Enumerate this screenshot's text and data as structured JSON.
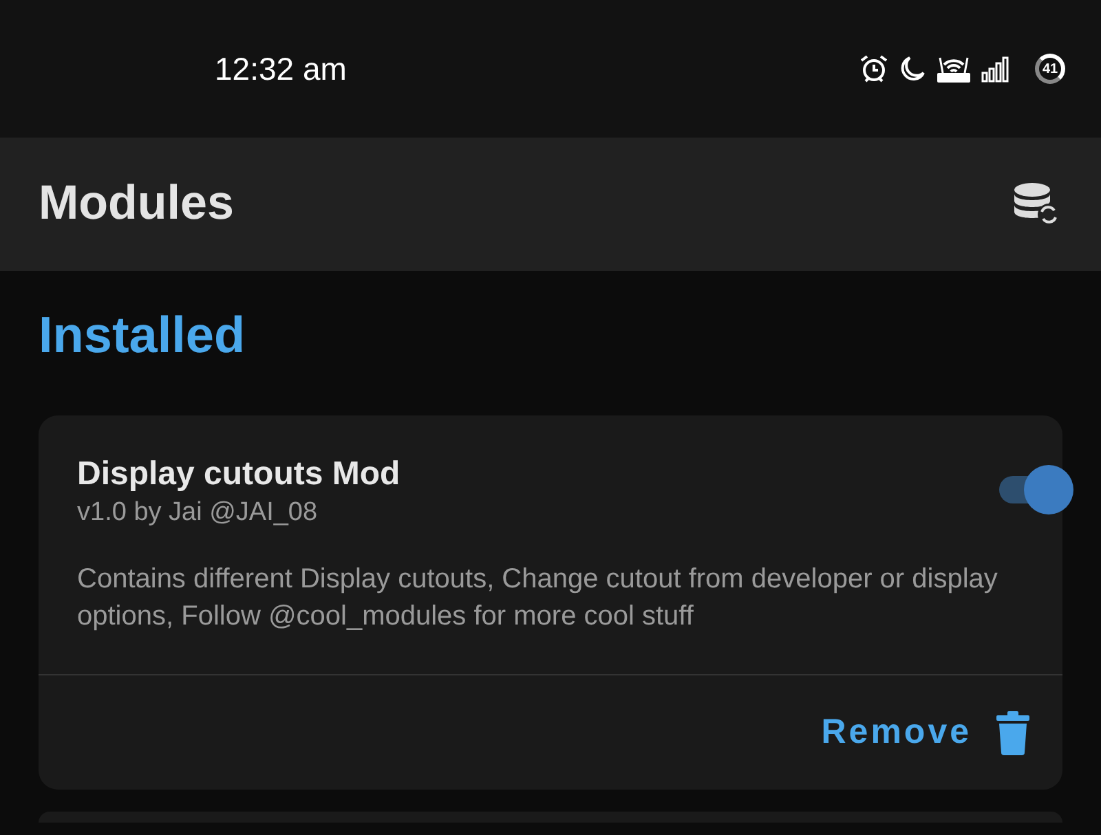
{
  "status_bar": {
    "time": "12:32 am",
    "battery": "41"
  },
  "app_bar": {
    "title": "Modules"
  },
  "section": {
    "title": "Installed"
  },
  "modules": [
    {
      "name": "Display cutouts Mod",
      "author_line": "v1.0 by Jai @JAI_08",
      "description": "Contains different Display cutouts, Change cutout from developer or display options, Follow @cool_modules for more cool stuff",
      "on": true,
      "action": "Remove"
    }
  ]
}
